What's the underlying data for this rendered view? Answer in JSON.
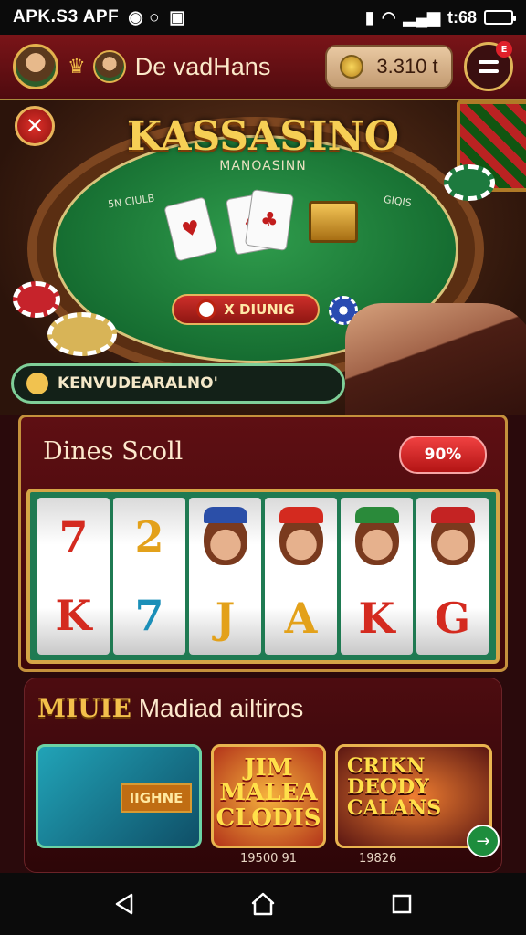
{
  "status_bar": {
    "left_text": "APK.S3 APF",
    "time": "t:68"
  },
  "header": {
    "title": "De vadHans",
    "coins": "3.310 t"
  },
  "hero": {
    "title": "KASSASINO",
    "subtitle": "MANOASINN",
    "side_left": "5N CIULB",
    "side_right": "GIQIS",
    "table_button": "X DIUNIG",
    "promo_text": "KENVUDEARALNO'"
  },
  "slots": {
    "title": "Dines Scoll",
    "badge": "90%",
    "reels": [
      {
        "top": "7",
        "bottom": "K",
        "top_color": "#d42a1f",
        "bottom_color": "#d42a1f"
      },
      {
        "top": "2",
        "bottom": "7",
        "top_color": "#e3a11a",
        "bottom_color": "#1b8fb8"
      },
      {
        "top": "face-icon",
        "bottom": "J",
        "top_color": "#2b4fa8",
        "bottom_color": "#e3a11a"
      },
      {
        "top": "face-icon",
        "bottom": "A",
        "top_color": "#d42a1f",
        "bottom_color": "#e3a11a"
      },
      {
        "top": "face-icon",
        "bottom": "K",
        "top_color": "#2a8a3a",
        "bottom_color": "#d42a1f"
      },
      {
        "top": "face-icon",
        "bottom": "G",
        "top_color": "#c42323",
        "bottom_color": "#d42a1f"
      }
    ]
  },
  "games": {
    "title_prefix": "MIUIE",
    "title_rest": " Madiad ailtiros",
    "cards": [
      {
        "label": "IIGHNE",
        "price": ""
      },
      {
        "label": "JIM\nMALEA\nCLODIS",
        "price": "19500 91"
      },
      {
        "label": "CRIKN\nDEODY\nCALANS",
        "price": "19826"
      }
    ]
  },
  "colors": {
    "brand_red": "#7a1418",
    "gold": "#e2b24d",
    "felt_green": "#146a2f",
    "badge_red": "#e0202a"
  }
}
